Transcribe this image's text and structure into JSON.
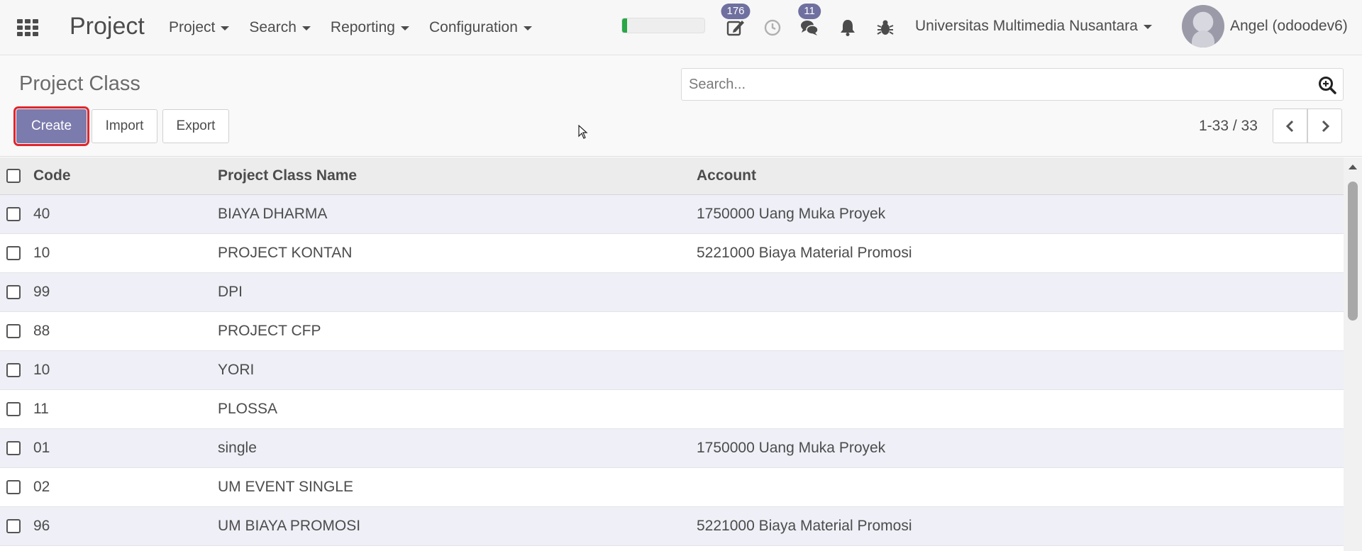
{
  "app": {
    "title": "Project"
  },
  "menu": [
    {
      "label": "Project"
    },
    {
      "label": "Search"
    },
    {
      "label": "Reporting"
    },
    {
      "label": "Configuration"
    }
  ],
  "systray": {
    "progress_fraction": 0.06,
    "activities_count": "176",
    "messages_count": "11",
    "company": "Universitas Multimedia Nusantara",
    "user": "Angel (odoodev6)",
    "icons": [
      "edit-icon",
      "clock-icon",
      "chat-icon",
      "bell-icon",
      "bug-icon"
    ]
  },
  "control_panel": {
    "title": "Project Class",
    "search_placeholder": "Search...",
    "create_label": "Create",
    "import_label": "Import",
    "export_label": "Export",
    "pager": "1-33 / 33"
  },
  "table": {
    "headers": {
      "code": "Code",
      "name": "Project Class Name",
      "account": "Account"
    },
    "rows": [
      {
        "code": "40",
        "name": "BIAYA DHARMA",
        "account": "1750000 Uang Muka Proyek"
      },
      {
        "code": "10",
        "name": "PROJECT KONTAN",
        "account": "5221000 Biaya Material Promosi"
      },
      {
        "code": "99",
        "name": "DPI",
        "account": ""
      },
      {
        "code": "88",
        "name": "PROJECT CFP",
        "account": ""
      },
      {
        "code": "10",
        "name": "YORI",
        "account": ""
      },
      {
        "code": "11",
        "name": "PLOSSA",
        "account": ""
      },
      {
        "code": "01",
        "name": "single",
        "account": "1750000 Uang Muka Proyek"
      },
      {
        "code": "02",
        "name": "UM EVENT SINGLE",
        "account": ""
      },
      {
        "code": "96",
        "name": "UM BIAYA PROMOSI",
        "account": "5221000 Biaya Material Promosi"
      }
    ]
  },
  "colors": {
    "primary": "#7c7bad",
    "badge": "#6f6fa0",
    "highlight": "#e0262b",
    "progress": "#28a745"
  }
}
